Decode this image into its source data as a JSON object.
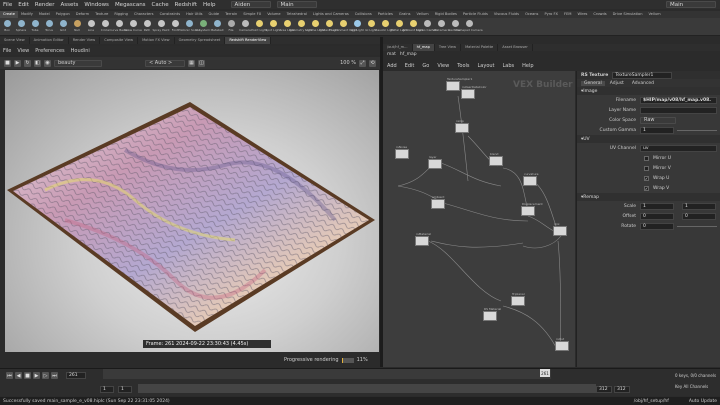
{
  "menubar": {
    "items": [
      "File",
      "Edit",
      "Render",
      "Assets",
      "Windows",
      "Megascans",
      "Cache",
      "Redshift",
      "Help"
    ],
    "desktop": "Aiden",
    "context": "Main",
    "right_context": "Main"
  },
  "shelf": {
    "tabs": [
      "Create",
      "Modify",
      "Model",
      "Polygon",
      "Deform",
      "Texture",
      "Rigging",
      "Characters",
      "Constraints",
      "Hair Utils",
      "Guide",
      "Terrain",
      "Simple FX",
      "Volume",
      "Tetrahedral",
      "Lights and Cameras",
      "Collisions",
      "Particles",
      "Grains",
      "Vellum",
      "Rigid Bodies",
      "Particle Fluids",
      "Viscous Fluids",
      "Oceans",
      "Pyro FX",
      "FEM",
      "Wires",
      "Crowds",
      "Drive Simulation",
      "Vellum"
    ],
    "active_tab": "Create",
    "tools": [
      "Box",
      "Sphere",
      "Tube",
      "Torus",
      "Grid",
      "Null",
      "Line",
      "Circle",
      "Curve Bezier",
      "Draw Curve",
      "Path",
      "Spray Paint",
      "Font",
      "Platonic Solids",
      "L-System",
      "Metaball",
      "File",
      "Camera",
      "Point Light",
      "Spot Light",
      "Area Light",
      "Geometry Light",
      "Volume Light",
      "Distant Light",
      "Environment Light",
      "Sky Light",
      "GI Light",
      "Caustic Light",
      "Portal Light",
      "Ambient Light",
      "Stereo Camera",
      "VR Camera",
      "Switcher",
      "Gamepad Camera"
    ]
  },
  "left_panel": {
    "tabs": [
      "Scene View",
      "Animation Editor",
      "Render View",
      "Composite View",
      "Motion FX View",
      "Geometry Spreadsheet",
      "Redshift RenderView"
    ],
    "active_tab": "Redshift RenderView",
    "menu": [
      "File",
      "View",
      "Preferences",
      "Houdini"
    ],
    "aov": "beauty",
    "auto": "< Auto >",
    "zoom": "100 %",
    "frame_info": "Frame: 261  2024-09-22  23:30:43  (4.45s)",
    "progress_label": "Progressive rendering",
    "progress_pct": "11%",
    "progress_value": 0.11
  },
  "network": {
    "tabs": [
      "/out/hf_m...",
      "hf_map",
      "Tree View",
      "Material Palette",
      "Asset Browser"
    ],
    "active_tab": "hf_map",
    "path": [
      "mat",
      "hf_map"
    ],
    "menu": [
      "Add",
      "Edit",
      "Go",
      "View",
      "Tools",
      "Layout",
      "Labs",
      "Help"
    ],
    "context_label": "VEX Builder",
    "nodes": [
      {
        "label": "TextureSampler1"
      },
      {
        "label": "rsUserDataColor"
      },
      {
        "label": "ramp"
      },
      {
        "label": "rsNoise"
      },
      {
        "label": "layer"
      },
      {
        "label": "blend"
      },
      {
        "label": "curvature"
      },
      {
        "label": "ambient"
      },
      {
        "label": "Displacement"
      },
      {
        "label": "rsMaterial"
      },
      {
        "label": "mix"
      },
      {
        "label": "Triplanar"
      },
      {
        "label": "rsOut"
      },
      {
        "label": "RS Material"
      }
    ]
  },
  "params": {
    "node_type": "RS Texture",
    "node_name": "TextureSampler1",
    "tabs": [
      "General",
      "Adjust",
      "Advanced"
    ],
    "active_tab": "General",
    "image_section": "Image",
    "filename_label": "Filename",
    "filename": "$HIP/map/v08/hf_map.v08.",
    "layer_name_label": "Layer Name",
    "color_space_label": "Color Space",
    "color_space": "Raw",
    "custom_gamma_label": "Custom Gamma",
    "custom_gamma": "1",
    "uv_section": "UV",
    "uv_channel_label": "UV Channel",
    "uv_channel": "uv",
    "mirror_u": "Mirror U",
    "mirror_v": "Mirror V",
    "wrap_u": "Wrap U",
    "wrap_v": "Wrap V",
    "remap_section": "Remap",
    "scale_label": "Scale",
    "scale_x": "1",
    "scale_y": "1",
    "offset_label": "Offset",
    "offset_x": "0",
    "offset_y": "0",
    "rotate_label": "Rotate",
    "rotate": "0"
  },
  "timeline": {
    "frame": "261",
    "start": "1",
    "start2": "1",
    "end": "312",
    "end2": "312",
    "current_marker": "261",
    "keys_label": "0 keys, 0/0 channels",
    "key_all_label": "Key All Channels",
    "auto_update": "Auto Update"
  },
  "status": {
    "message": "Successfully saved main_sample_e_v08.hiplc (Sun Sep 22 23:31:05 2024)",
    "path": "/obj/hf_setup/hf"
  },
  "colors": {
    "accent": "#e3b23c",
    "frame_wood": "#6b4a2e"
  }
}
